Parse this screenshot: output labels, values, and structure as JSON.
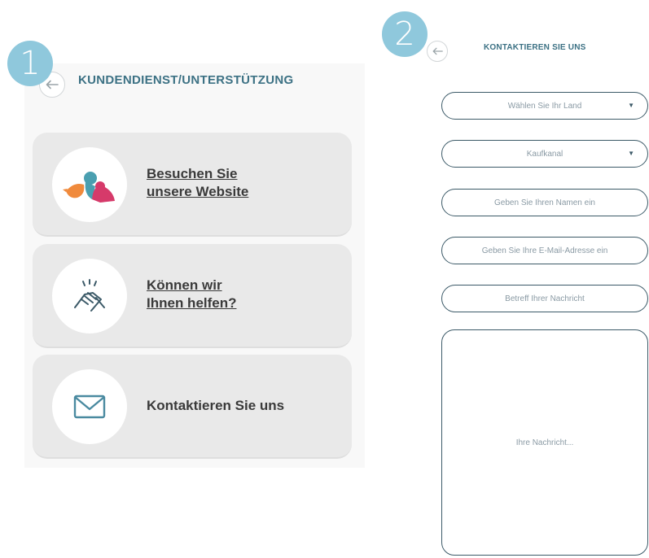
{
  "screen1": {
    "step_number": "1",
    "title": "KUNDENDIENST/UNTERSTÜTZUNG",
    "cards": [
      {
        "line1": "Besuchen Sie",
        "line2": "unsere Website",
        "icon": "birds-logo-icon"
      },
      {
        "line1": "Können wir",
        "line2": "Ihnen helfen?",
        "icon": "handshake-icon"
      },
      {
        "line1": "Kontaktieren Sie uns",
        "line2": "",
        "icon": "envelope-icon"
      }
    ]
  },
  "screen2": {
    "step_number": "2",
    "title": "KONTAKTIEREN SIE UNS",
    "country_select": "Wählen Sie Ihr Land",
    "channel_select": "Kaufkanal",
    "name_placeholder": "Geben Sie Ihren Namen ein",
    "email_placeholder": "Geben Sie Ihre E-Mail-Adresse ein",
    "subject_placeholder": "Betreff Ihrer Nachricht",
    "message_placeholder": "Ihre Nachricht..."
  },
  "colors": {
    "accent_badge": "#8fc8dc",
    "title_teal": "#3c7184",
    "field_border": "#3c5a68",
    "card_bg": "#e9e9e9"
  }
}
